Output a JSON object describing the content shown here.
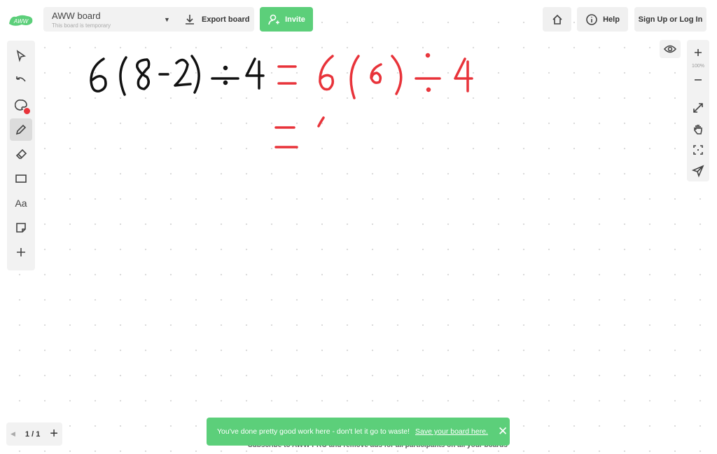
{
  "header": {
    "logo": "AWW",
    "board_title": "AWW board",
    "board_subtitle": "This board is temporary",
    "export_label": "Export board",
    "invite_label": "Invite",
    "help_label": "Help",
    "signup_label": "Sign Up or Log In"
  },
  "tools": [
    {
      "icon": "cursor-icon"
    },
    {
      "icon": "undo-icon"
    },
    {
      "icon": "palette-icon"
    },
    {
      "icon": "pencil-icon",
      "active": true
    },
    {
      "icon": "eraser-icon"
    },
    {
      "icon": "rectangle-icon"
    },
    {
      "icon": "text-icon",
      "label": "Aa"
    },
    {
      "icon": "sticky-note-icon"
    },
    {
      "icon": "plus-icon"
    }
  ],
  "zoom": {
    "level": "100%"
  },
  "pager": {
    "label": "1 / 1"
  },
  "toast": {
    "message": "You've done pretty good work here - don't let it go to waste!",
    "link": "Save your board here.",
    "underneath": "Subscribe to AWW PRO and remove ads for all participants on all your boards"
  },
  "colors": {
    "accent": "#5ccf7a",
    "ink_black": "#111111",
    "ink_red": "#e8333a"
  }
}
